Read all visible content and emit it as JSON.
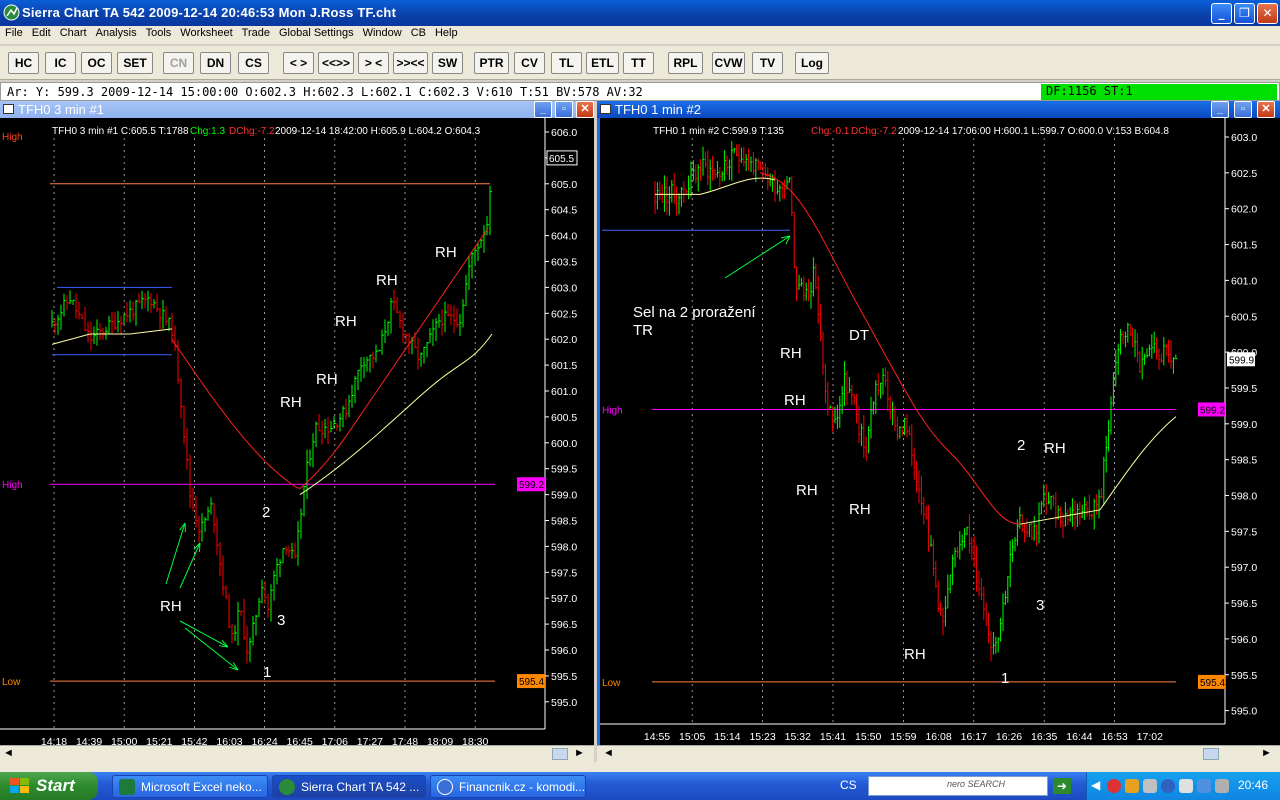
{
  "window": {
    "title": "Sierra Chart TA 542  2009-12-14  20:46:53  Mon   J.Ross TF.cht"
  },
  "menu": [
    "File",
    "Edit",
    "Chart",
    "Analysis",
    "Tools",
    "Worksheet",
    "Trade",
    "Global Settings",
    "Window",
    "CB",
    "Help"
  ],
  "toolbar": [
    {
      "label": "HC",
      "enabled": true
    },
    {
      "label": "IC",
      "enabled": true
    },
    {
      "label": "OC",
      "enabled": true
    },
    {
      "label": "SET",
      "enabled": true
    },
    {
      "label": "CN",
      "enabled": false
    },
    {
      "label": "DN",
      "enabled": true
    },
    {
      "label": "CS",
      "enabled": true
    },
    {
      "label": "< >",
      "enabled": true
    },
    {
      "label": "<<>>",
      "enabled": true
    },
    {
      "label": "> <",
      "enabled": true
    },
    {
      "label": ">><<",
      "enabled": true
    },
    {
      "label": "SW",
      "enabled": true
    },
    {
      "label": "PTR",
      "enabled": true
    },
    {
      "label": "CV",
      "enabled": true
    },
    {
      "label": "TL",
      "enabled": true
    },
    {
      "label": "ETL",
      "enabled": true
    },
    {
      "label": "TT",
      "enabled": true
    },
    {
      "label": "RPL",
      "enabled": true
    },
    {
      "label": "CVW",
      "enabled": true
    },
    {
      "label": "TV",
      "enabled": true
    },
    {
      "label": "Log",
      "enabled": true
    }
  ],
  "infobar": {
    "left": "Ar: Y: 599.3  2009-12-14  15:00:00  O:602.3  H:602.3  L:602.1  C:602.3  V:610  T:51  BV:578  AV:32",
    "right": "DF:1156  ST:1"
  },
  "colors": {
    "bull": "#00ff00",
    "bear": "#ff0000",
    "ma_slow": "#ff2020",
    "ma_fast": "#ffffa0",
    "high_line": "#ff00ff",
    "low_line": "#ff8040",
    "range_line": "#4060ff"
  },
  "chart1": {
    "window_title": "TFH0  3 min   #1",
    "header": [
      "TFH0  3 min   #1  C:605.5  T:1788",
      "Chg:1.3",
      "DChg:-7.2",
      "2009-12-14  18:42:00  H:605.9  L:604.2  O:604.3"
    ],
    "y_ticks": [
      "606.0",
      "605.5",
      "605.0",
      "604.5",
      "604.0",
      "603.5",
      "603.0",
      "602.5",
      "602.0",
      "601.5",
      "601.0",
      "600.5",
      "600.0",
      "599.5",
      "599.0",
      "598.5",
      "598.0",
      "597.5",
      "597.0",
      "596.5",
      "596.0",
      "595.5",
      "595.0"
    ],
    "x_ticks": [
      "14:18",
      "14:39",
      "15:00",
      "15:21",
      "15:42",
      "16:03",
      "16:24",
      "16:45",
      "17:06",
      "17:27",
      "17:48",
      "18:09",
      "18:30"
    ],
    "price_tag": "605.5",
    "high_tag": "599.2",
    "low_tag": "595.4",
    "high_label": "High",
    "low_label": "Low",
    "high_label_top": "High",
    "annotations": [
      "RH",
      "RH",
      "RH",
      "RH",
      "RH",
      "RH",
      "2",
      "3",
      "1"
    ]
  },
  "chart2": {
    "window_title": "TFH0  1 min   #2",
    "header": [
      "TFH0  1 min   #2  C:599.9  T:135",
      "Chg:-0.1",
      "DChg:-7.2",
      "2009-12-14  17:06:00  H:600.1  L:599.7  O:600.0  V:153  B:604.8"
    ],
    "y_ticks": [
      "603.0",
      "602.5",
      "602.0",
      "601.5",
      "601.0",
      "600.5",
      "600.0",
      "599.5",
      "599.0",
      "598.5",
      "598.0",
      "597.5",
      "597.0",
      "596.5",
      "596.0",
      "595.5",
      "595.0"
    ],
    "x_ticks": [
      "14:55",
      "15:05",
      "15:14",
      "15:23",
      "15:32",
      "15:41",
      "15:50",
      "15:59",
      "16:08",
      "16:17",
      "16:26",
      "16:35",
      "16:44",
      "16:53",
      "17:02"
    ],
    "price_tag": "599.9",
    "high_tag": "599.2",
    "low_tag": "595.4",
    "high_label": "High",
    "low_label": "Low",
    "note_line1": "Sel na 2 proražení",
    "note_line2": "TR",
    "annotations": [
      "RH",
      "DT",
      "RH",
      "RH",
      "RH",
      "RH",
      "2",
      "RH",
      "3",
      "1"
    ]
  },
  "taskbar": {
    "start": "Start",
    "tasks": [
      "Microsoft Excel neko...",
      "Sierra Chart TA 542 ...",
      "Financnik.cz - komodi..."
    ],
    "lang": "CS",
    "search": "nero SEARCH",
    "clock": "20:46"
  }
}
